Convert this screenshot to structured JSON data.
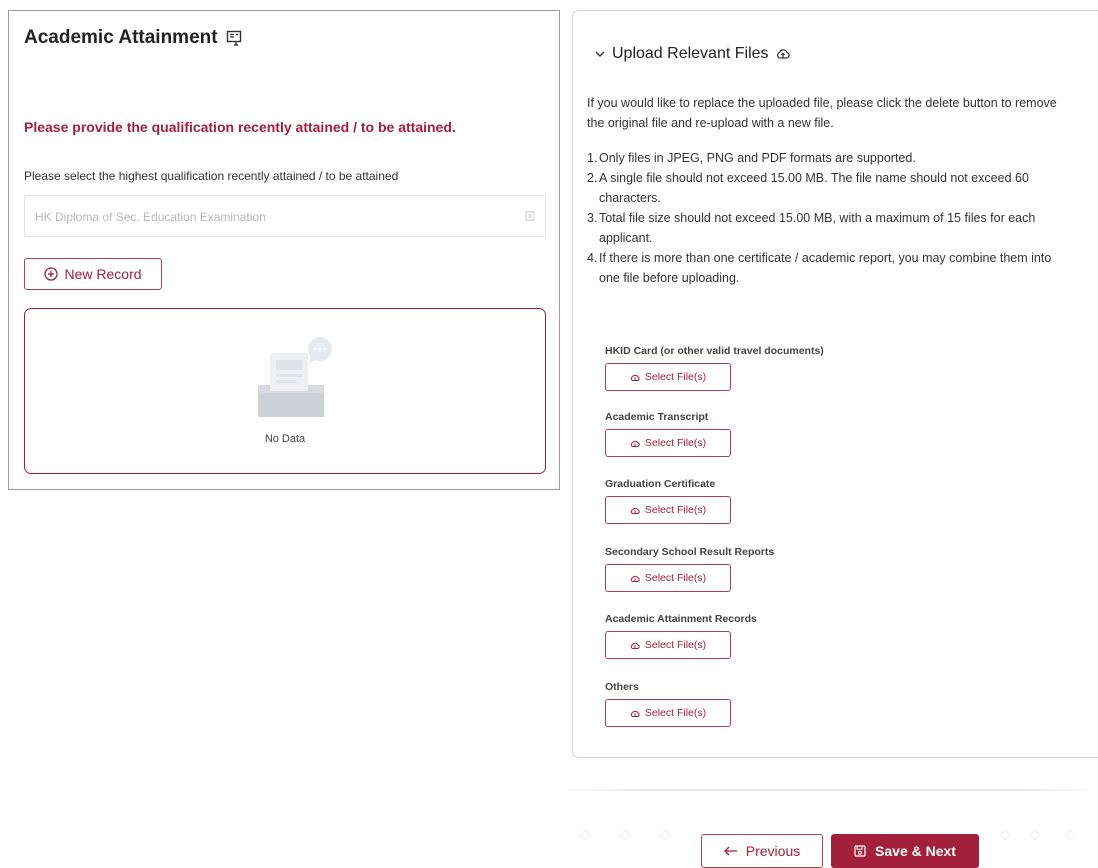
{
  "left_panel": {
    "title": "Academic Attainment",
    "prompt": "Please provide the qualification recently attained / to be attained.",
    "select_label": "Please select the highest qualification recently attained / to be attained",
    "select_value": "HK Diploma of Sec. Education Examination",
    "new_record_label": "New Record",
    "empty_text": "No Data"
  },
  "right_panel": {
    "header": "Upload Relevant Files",
    "intro": "If you would like to replace the uploaded file, please click the delete button to remove the original file and re-upload with a new file.",
    "rules": [
      {
        "num": "1.",
        "text": "Only files in JPEG, PNG and PDF formats are supported."
      },
      {
        "num": "2.",
        "text": "A single file should not exceed 15.00 MB. The file name should not exceed 60 characters."
      },
      {
        "num": "3.",
        "text": "Total file size should not exceed 15.00 MB, with a maximum of 15 files for each applicant."
      },
      {
        "num": "4.",
        "text": "If there is more than one certificate / academic report, you may combine them into one file before uploading."
      }
    ],
    "file_sections": [
      {
        "label": "HKID Card (or other valid travel documents)",
        "button": "Select File(s)"
      },
      {
        "label": "Academic Transcript",
        "button": "Select File(s)"
      },
      {
        "label": "Graduation Certificate",
        "button": "Select File(s)"
      },
      {
        "label": "Secondary School Result Reports",
        "button": "Select File(s)"
      },
      {
        "label": "Academic Attainment Records",
        "button": "Select File(s)"
      },
      {
        "label": "Others",
        "button": "Select File(s)"
      }
    ]
  },
  "footer": {
    "previous_label": "Previous",
    "save_next_label": "Save & Next"
  },
  "colors": {
    "accent": "#a3203a",
    "border": "#d8d8d8",
    "placeholder": "#b8b8b8"
  }
}
